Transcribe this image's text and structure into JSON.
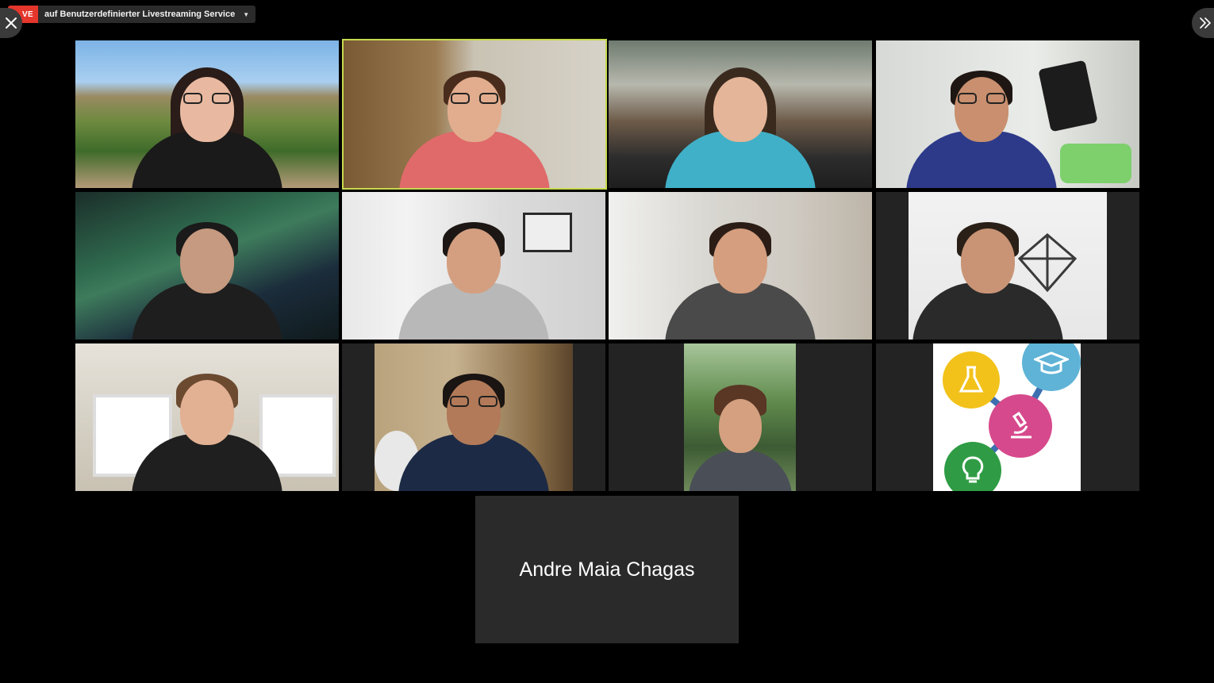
{
  "live": {
    "badge": "VE",
    "service": "auf Benutzerdefinierter Livestreaming Service"
  },
  "controls": {
    "close_icon": "close-icon",
    "expand_icon": "chevrons-right-icon"
  },
  "grid": {
    "active_color": "#c7d94f",
    "tiles": [
      {
        "id": "participant-1",
        "desc": "video"
      },
      {
        "id": "participant-2",
        "desc": "video",
        "active": true
      },
      {
        "id": "participant-3",
        "desc": "video"
      },
      {
        "id": "participant-4",
        "desc": "video"
      },
      {
        "id": "participant-5",
        "desc": "video"
      },
      {
        "id": "participant-6",
        "desc": "video"
      },
      {
        "id": "participant-7",
        "desc": "video"
      },
      {
        "id": "participant-8",
        "desc": "video"
      },
      {
        "id": "participant-9",
        "desc": "video"
      },
      {
        "id": "participant-10",
        "desc": "video"
      },
      {
        "id": "participant-11",
        "desc": "video"
      },
      {
        "id": "participant-12",
        "desc": "logo"
      }
    ]
  },
  "name_tile": {
    "name": "Andre Maia Chagas"
  }
}
